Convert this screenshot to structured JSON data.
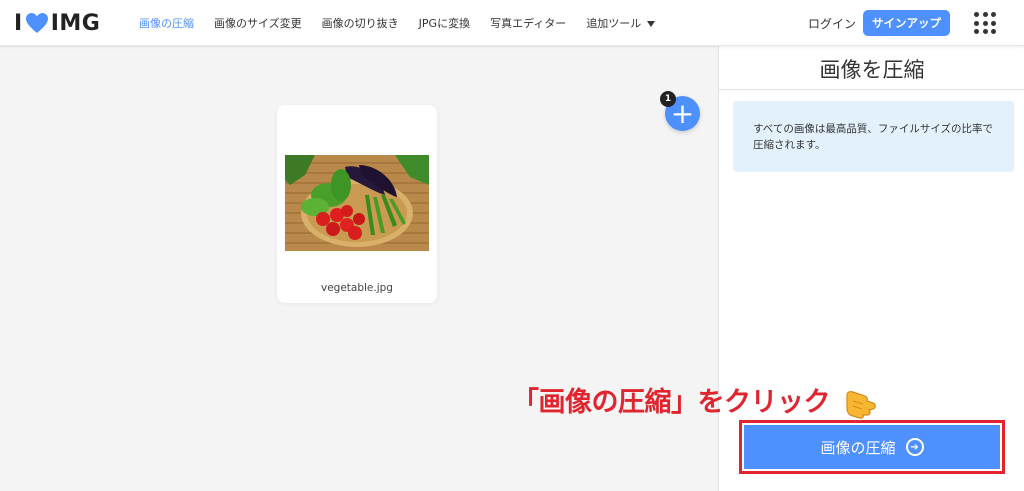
{
  "brand": {
    "left": "I",
    "right": "IMG",
    "heart_color": "#4d90fe"
  },
  "nav": {
    "items": [
      {
        "label": "画像の圧縮",
        "active": true
      },
      {
        "label": "画像のサイズ変更",
        "active": false
      },
      {
        "label": "画像の切り抜き",
        "active": false
      },
      {
        "label": "JPGに変換",
        "active": false
      },
      {
        "label": "写真エディター",
        "active": false
      },
      {
        "label": "追加ツール",
        "active": false
      }
    ]
  },
  "header": {
    "login_label": "ログイン",
    "signup_label": "サインアップ"
  },
  "workspace": {
    "file": {
      "name": "vegetable.jpg"
    },
    "add_badge_count": "1"
  },
  "sidebar": {
    "title": "画像を圧縮",
    "info_text": "すべての画像は最高品質、ファイルサイズの比率で圧縮されます。"
  },
  "annotation": {
    "text": "「画像の圧縮」をクリック"
  },
  "action": {
    "compress_label": "画像の圧縮"
  },
  "colors": {
    "accent": "#4d90fe",
    "annotation_red": "#e0252f",
    "info_bg": "#e3f1fd"
  }
}
